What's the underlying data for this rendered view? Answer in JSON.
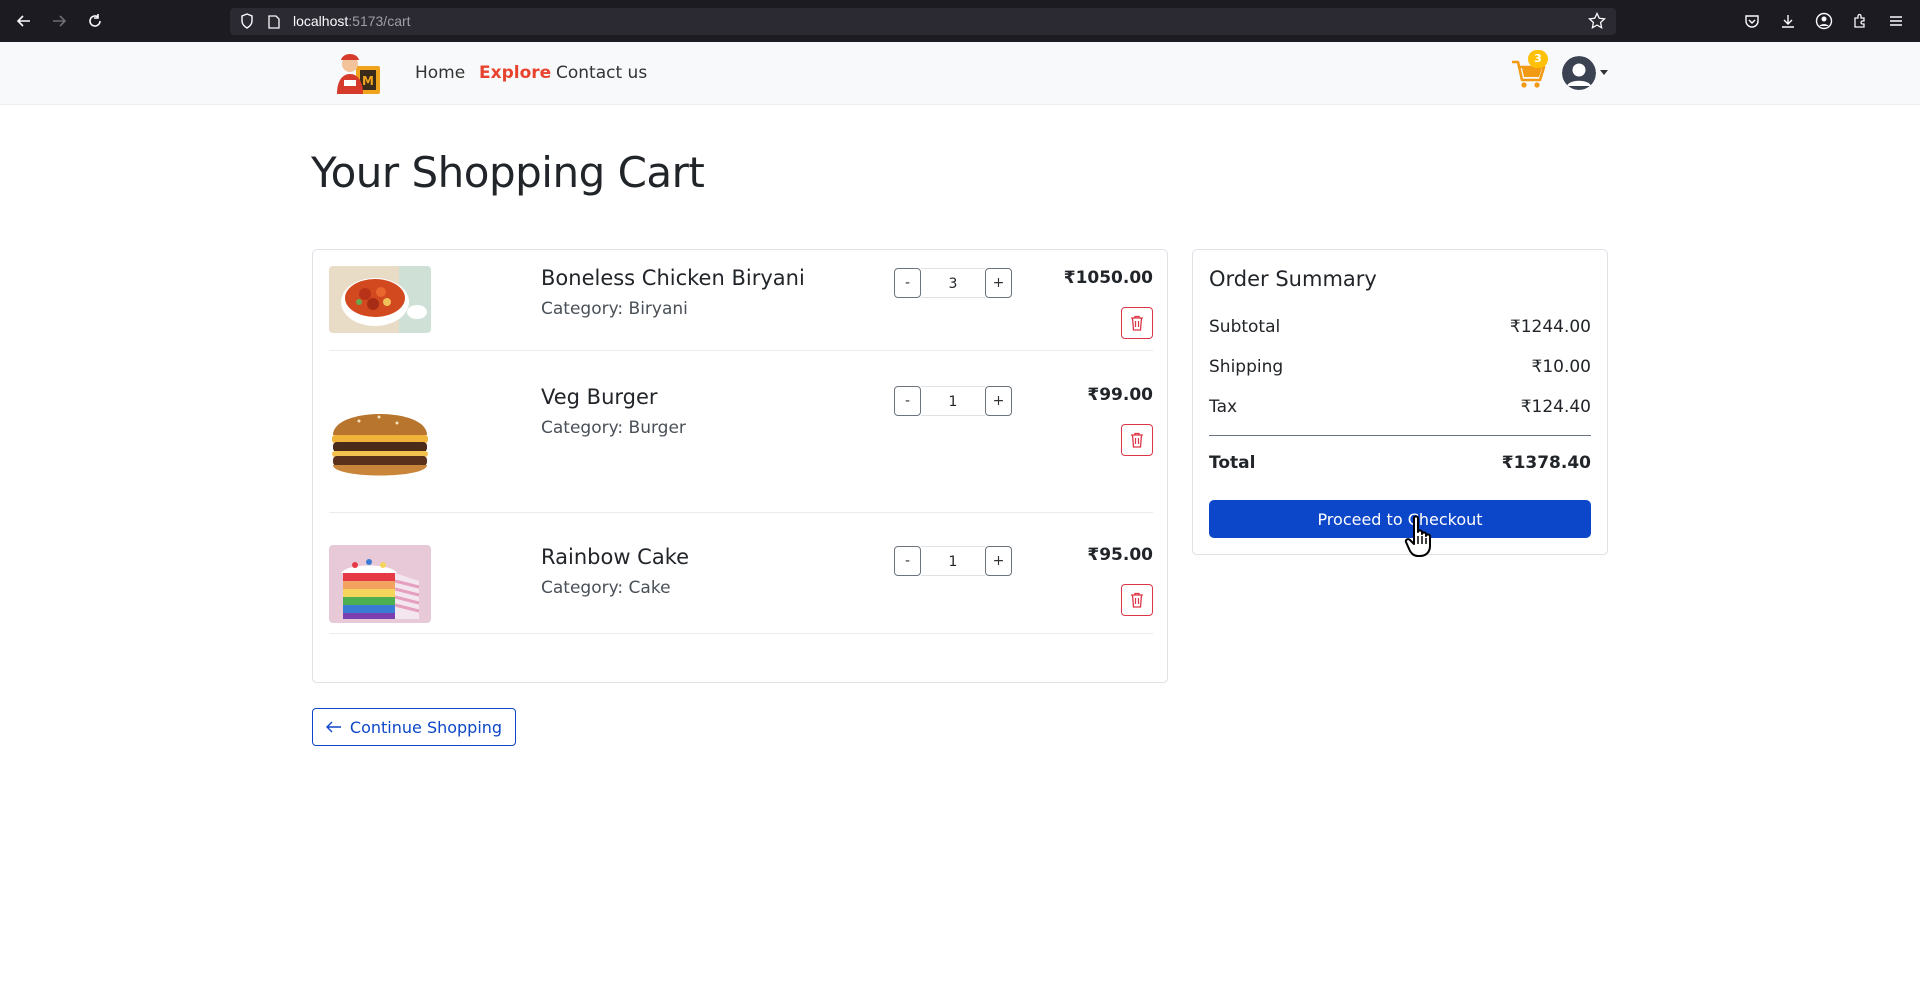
{
  "browser": {
    "url_host": "localhost",
    "url_path": ":5173/cart"
  },
  "nav": {
    "links": [
      {
        "label": "Home"
      },
      {
        "label": "Explore"
      },
      {
        "label": "Contact us"
      }
    ],
    "active_link": "Explore",
    "cart_count": "3"
  },
  "page": {
    "title": "Your Shopping Cart"
  },
  "cart": {
    "items": [
      {
        "name": "Boneless Chicken Biryani",
        "category": "Category: Biryani",
        "quantity": "3",
        "price": "₹1050.00",
        "image_icon": "biryani-image"
      },
      {
        "name": "Veg Burger",
        "category": "Category: Burger",
        "quantity": "1",
        "price": "₹99.00",
        "image_icon": "burger-image"
      },
      {
        "name": "Rainbow Cake",
        "category": "Category: Cake",
        "quantity": "1",
        "price": "₹95.00",
        "image_icon": "cake-image"
      }
    ],
    "decrement_label": "-",
    "increment_label": "+",
    "continue_label": "Continue Shopping"
  },
  "summary": {
    "title": "Order Summary",
    "subtotal_label": "Subtotal",
    "subtotal_value": "₹1244.00",
    "shipping_label": "Shipping",
    "shipping_value": "₹10.00",
    "tax_label": "Tax",
    "tax_value": "₹124.40",
    "total_label": "Total",
    "total_value": "₹1378.40",
    "checkout_label": "Proceed to Checkout"
  },
  "colors": {
    "brand_primary": "#0d47c9",
    "active_nav": "#e8432e",
    "danger": "#dc3545",
    "badge": "#ffc107"
  }
}
